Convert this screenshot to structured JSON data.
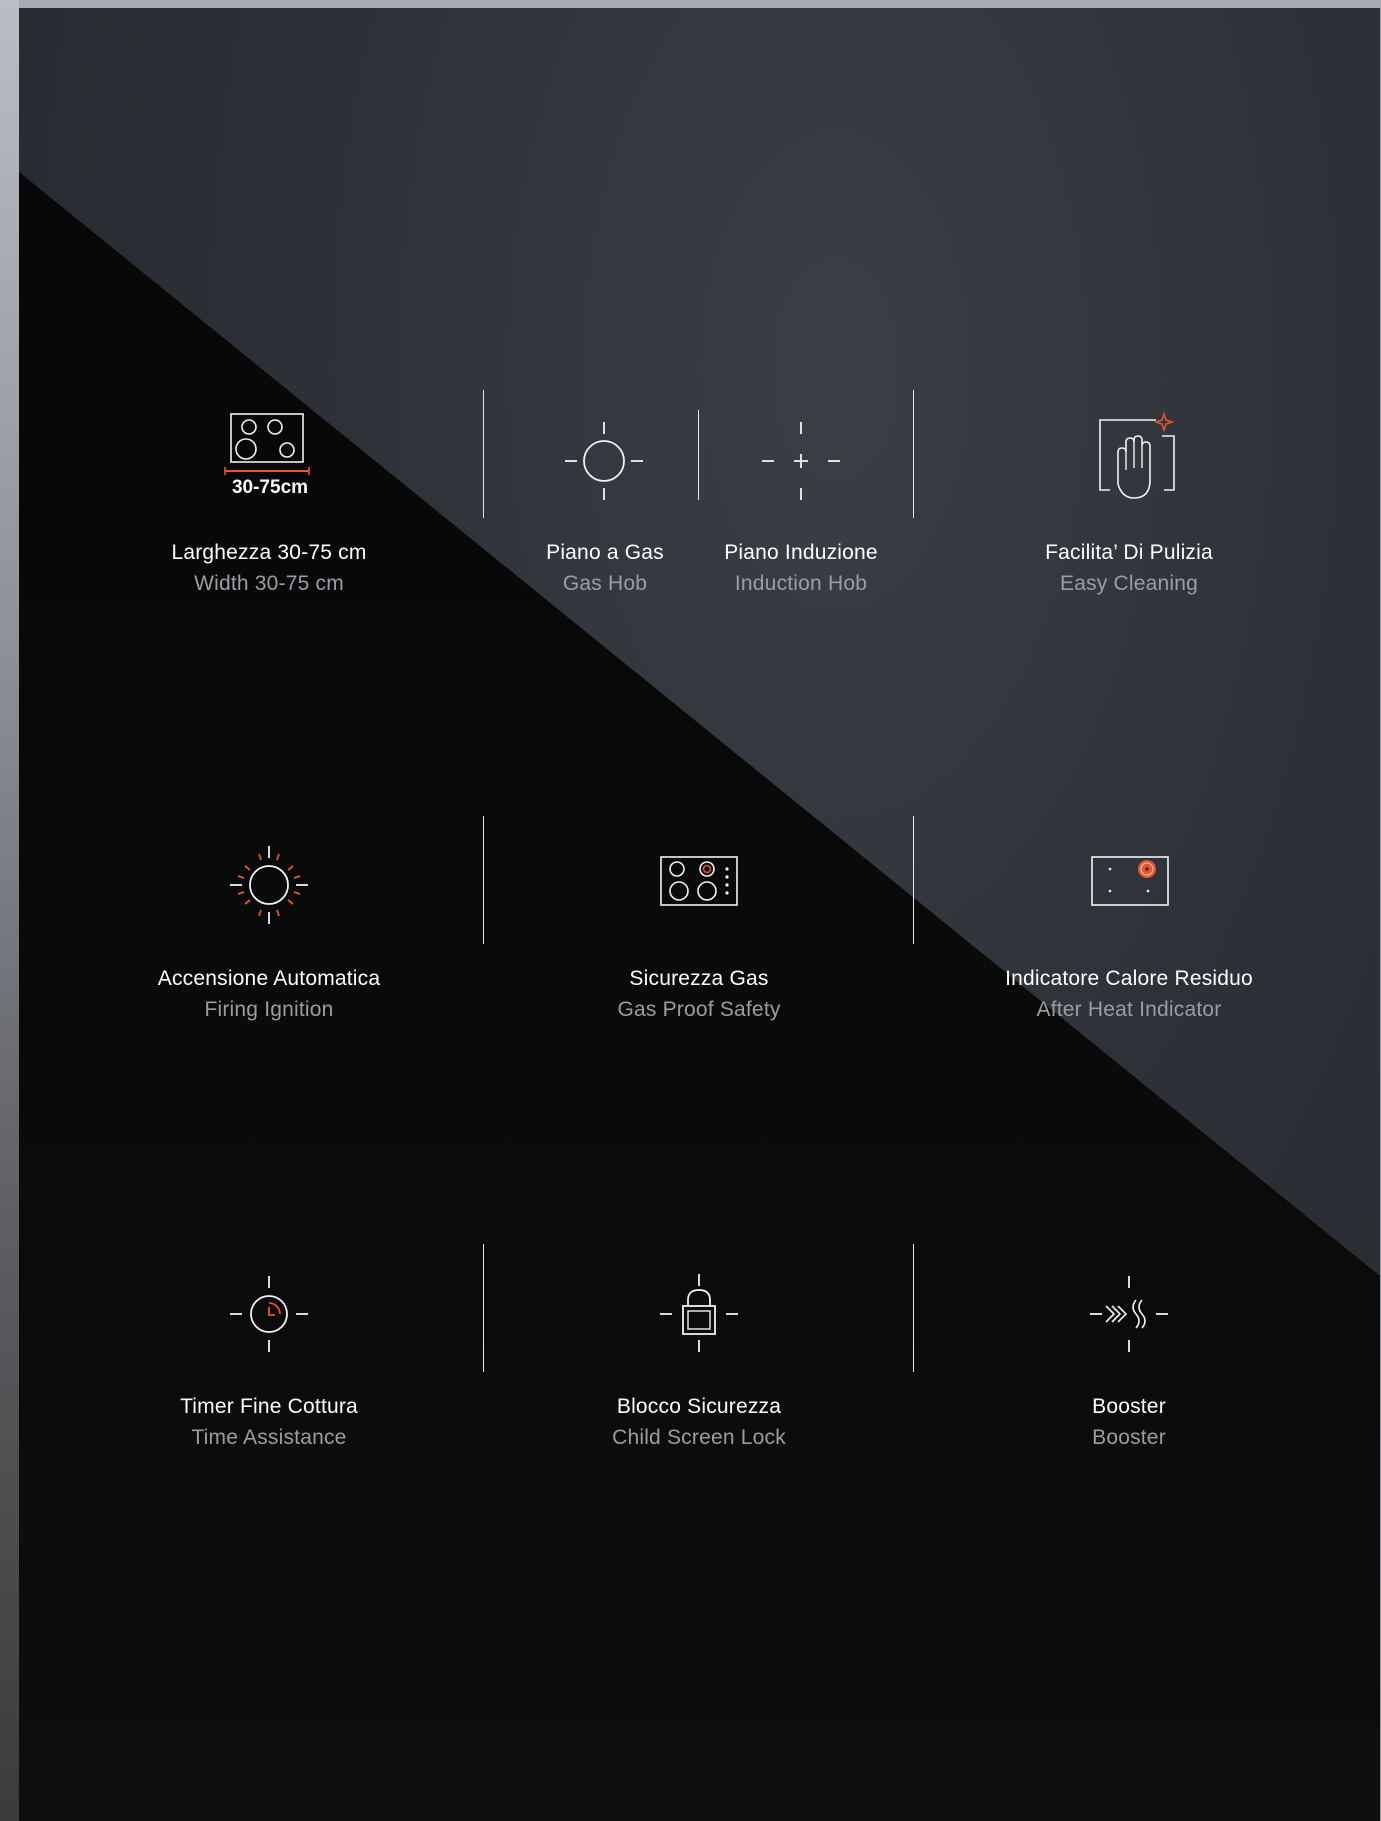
{
  "colors": {
    "accent": "#e4572e",
    "line": "#f2f2f2",
    "title": "#ffffff",
    "subtitle": "#9a9ea4"
  },
  "rows": [
    {
      "features": [
        {
          "icon": "hob-width-icon",
          "width_label": "30-75cm",
          "title": "Larghezza 30-75 cm",
          "subtitle": "Width 30-75 cm"
        },
        {
          "icon": "gas-burner-icon",
          "title": "Piano a Gas",
          "subtitle": "Gas Hob"
        },
        {
          "icon": "induction-icon",
          "title": "Piano Induzione",
          "subtitle": "Induction Hob"
        },
        {
          "icon": "cleaning-hand-icon",
          "title": "Facilita’ Di Pulizia",
          "subtitle": "Easy Cleaning"
        }
      ]
    },
    {
      "features": [
        {
          "icon": "ignition-sun-icon",
          "title": "Accensione Automatica",
          "subtitle": "Firing Ignition"
        },
        {
          "icon": "gas-safety-hob-icon",
          "title": "Sicurezza Gas",
          "subtitle": "Gas Proof Safety"
        },
        {
          "icon": "residual-heat-icon",
          "title": "Indicatore Calore Residuo",
          "subtitle": "After Heat Indicator"
        }
      ]
    },
    {
      "features": [
        {
          "icon": "timer-icon",
          "title": "Timer Fine Cottura",
          "subtitle": "Time Assistance"
        },
        {
          "icon": "padlock-icon",
          "title": "Blocco Sicurezza",
          "subtitle": "Child Screen Lock"
        },
        {
          "icon": "booster-icon",
          "title": "Booster",
          "subtitle": "Booster"
        }
      ]
    }
  ]
}
